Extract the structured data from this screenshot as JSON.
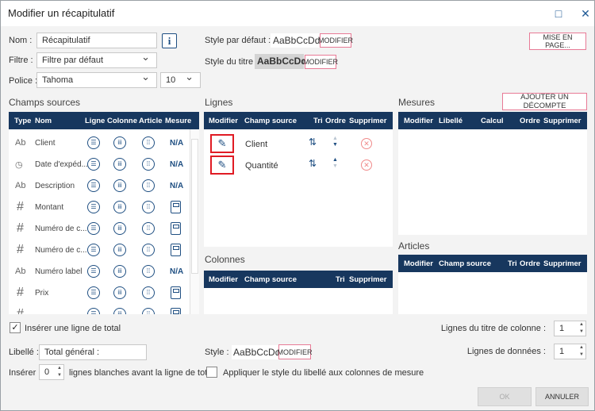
{
  "window": {
    "title": "Modifier un récapitulatif",
    "maximize_icon": "□",
    "close_icon": "✕"
  },
  "form": {
    "nom_label": "Nom :",
    "nom_value": "Récapitulatif",
    "info_icon": "i",
    "filtre_label": "Filtre :",
    "filtre_value": "Filtre par défaut",
    "police_label": "Police :",
    "police_value": "Tahoma",
    "size_value": "10",
    "style_defaut_label": "Style par défaut :",
    "style_defaut_sample": "AaBbCcDd",
    "modifier": "MODIFIER",
    "style_titre_label": "Style du titre :",
    "style_titre_sample": "AaBbCcDd",
    "mise_en_page": "MISE EN PAGE..."
  },
  "champs": {
    "heading": "Champs sources",
    "columns": [
      "Type",
      "Nom",
      "Ligne",
      "Colonne",
      "Article",
      "Mesure"
    ],
    "rows": [
      {
        "type": "Ab",
        "name": "Client",
        "measure": "N/A"
      },
      {
        "type": "◷",
        "name": "Date d'expéd...",
        "measure": "N/A"
      },
      {
        "type": "Ab",
        "name": "Description",
        "measure": "N/A"
      },
      {
        "type": "#",
        "name": "Montant",
        "measure": "calc"
      },
      {
        "type": "#",
        "name": "Numéro de c...",
        "measure": "calc"
      },
      {
        "type": "#",
        "name": "Numéro de c...",
        "measure": "calc"
      },
      {
        "type": "Ab",
        "name": "Numéro label",
        "measure": "N/A"
      },
      {
        "type": "#",
        "name": "Prix",
        "measure": "calc"
      },
      {
        "type": "#",
        "name": "",
        "measure": "calc"
      }
    ]
  },
  "lignes": {
    "heading": "Lignes",
    "columns": [
      "Modifier",
      "Champ source",
      "Tri",
      "Ordre",
      "Supprimer"
    ],
    "rows": [
      {
        "source": "Client"
      },
      {
        "source": "Quantité"
      }
    ]
  },
  "colonnes": {
    "heading": "Colonnes",
    "columns": [
      "Modifier",
      "Champ source",
      "Tri",
      "Supprimer"
    ]
  },
  "mesures": {
    "heading": "Mesures",
    "add_button": "AJOUTER UN DÉCOMPTE",
    "columns": [
      "Modifier",
      "Libellé",
      "Calcul",
      "Ordre",
      "Supprimer"
    ]
  },
  "articles": {
    "heading": "Articles",
    "columns": [
      "Modifier",
      "Champ source",
      "Tri",
      "Ordre",
      "Supprimer"
    ]
  },
  "bottom": {
    "total_check": "Insérer une ligne de total",
    "total_checked": true,
    "libelle_label": "Libellé :",
    "libelle_value": "Total général :",
    "style_label": "Style :",
    "style_sample": "AaBbCcDd",
    "inserer_label": "Insérer",
    "inserer_value": "0",
    "inserer_suffix": "lignes blanches avant la ligne de total.",
    "appliquer": "Appliquer le style du libellé aux colonnes de mesure",
    "appliquer_checked": false,
    "titre_col_label": "Lignes du titre de colonne :",
    "titre_col_value": "1",
    "donnees_label": "Lignes de données :",
    "donnees_value": "1",
    "ok": "OK",
    "annuler": "ANNULER"
  }
}
